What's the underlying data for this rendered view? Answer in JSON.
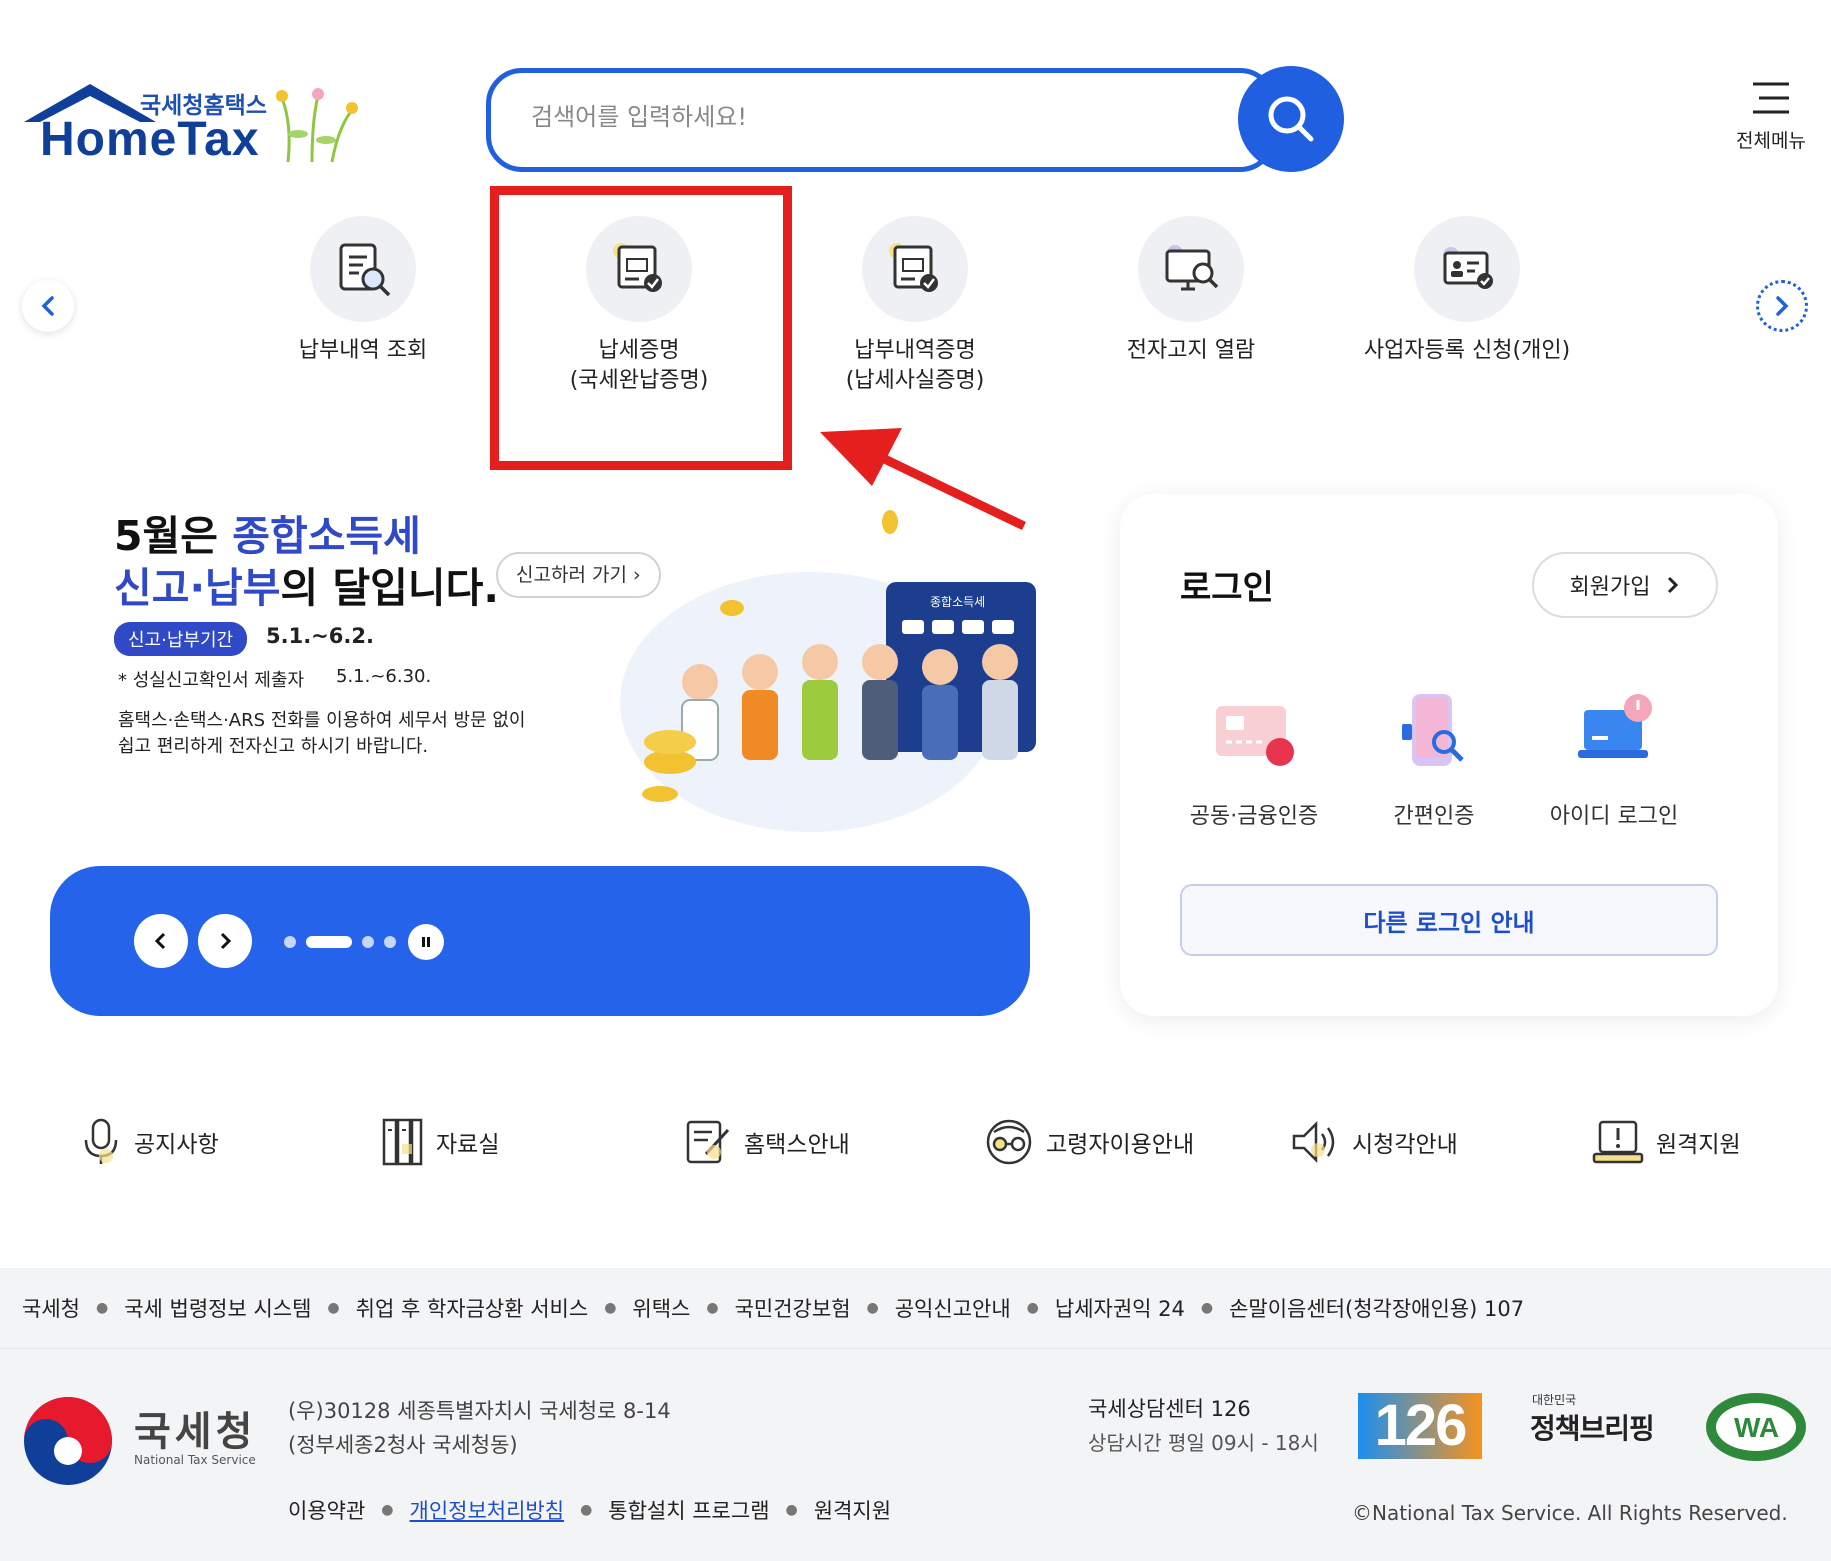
{
  "header": {
    "logo_small": "국세청홈택스",
    "logo_big": "HomeTax",
    "search_placeholder": "검색어를 입력하세요!",
    "menu_label": "전체메뉴"
  },
  "quick_menu": [
    {
      "label": "납부내역 조회",
      "icon": "document-search-icon"
    },
    {
      "label": "납세증명\n(국세완납증명)",
      "icon": "tax-certificate-icon"
    },
    {
      "label": "납부내역증명\n(납세사실증명)",
      "icon": "tax-certificate-icon"
    },
    {
      "label": "전자고지 열람",
      "icon": "monitor-search-icon"
    },
    {
      "label": "사업자등록 신청(개인)",
      "icon": "id-card-check-icon"
    }
  ],
  "banner": {
    "line1_prefix": "5월은 ",
    "line1_accent": "종합소득세",
    "line2_accent": "신고·납부",
    "line2_suffix": "의 달입니다.",
    "cta": "신고하러 가기",
    "pill": "신고·납부기간",
    "period": "5.1.~6.2.",
    "note1": "성실신고확인서 제출자",
    "note1_period": "5.1.~6.30.",
    "note2": "홈택스·손택스·ARS 전화를 이용하여 세무서 방문 없이\n쉽고 편리하게 전자신고 하시기 바랍니다.",
    "calculator_label": "종합소득세"
  },
  "login": {
    "title": "로그인",
    "join": "회원가입",
    "options": [
      {
        "label": "공동·금융인증",
        "icon": "certificate-card-icon"
      },
      {
        "label": "간편인증",
        "icon": "phone-search-icon"
      },
      {
        "label": "아이디 로그인",
        "icon": "laptop-power-icon"
      }
    ],
    "other": "다른 로그인 안내"
  },
  "shortcuts": [
    {
      "label": "공지사항",
      "icon": "microphone-icon"
    },
    {
      "label": "자료실",
      "icon": "archive-icon"
    },
    {
      "label": "홈택스안내",
      "icon": "edit-document-icon"
    },
    {
      "label": "고령자이용안내",
      "icon": "senior-glasses-icon"
    },
    {
      "label": "시청각안내",
      "icon": "speaker-icon"
    },
    {
      "label": "원격지원",
      "icon": "remote-laptop-icon"
    }
  ],
  "footer": {
    "links": [
      "국세청",
      "국세 법령정보 시스템",
      "취업 후 학자금상환 서비스",
      "위택스",
      "국민건강보험",
      "공익신고안내",
      "납세자권익 24",
      "손말이음센터(청각장애인용) 107"
    ],
    "org_name": "국세청",
    "org_en": "National Tax Service",
    "address1": "(우)30128 세종특별자치시 국세청로 8-14",
    "address2": "(정부세종2청사 국세청동)",
    "bottom_links": [
      "이용약관",
      "개인정보처리방침",
      "통합설치 프로그램",
      "원격지원"
    ],
    "center_name": "국세상담센터 126",
    "center_hours": "상담시간 평일 09시 - 18시",
    "badge_126": "126",
    "policy_small": "대한민국",
    "policy_big": "정책브리핑",
    "wa_label": "WA",
    "copyright": "©National Tax Service. All Rights Reserved."
  },
  "colors": {
    "primary": "#1f5fe0",
    "highlight_red": "#e51e1e",
    "banner_accent": "#2f49c7"
  }
}
